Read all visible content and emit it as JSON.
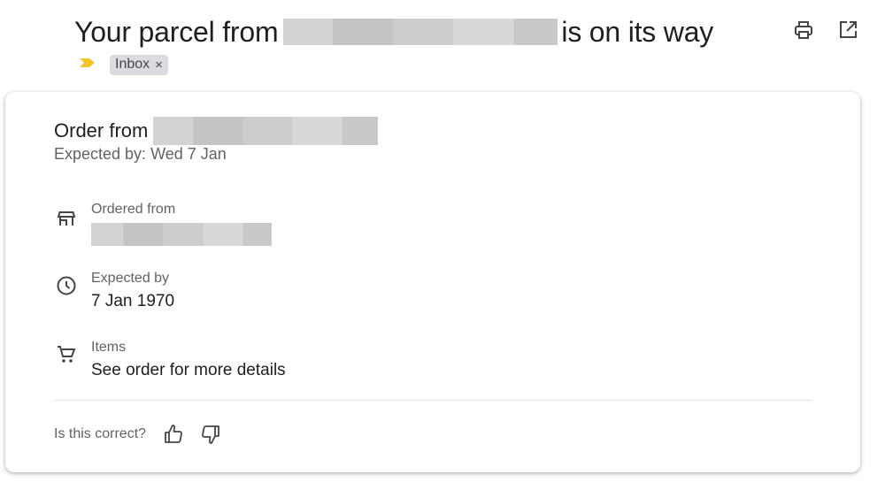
{
  "email": {
    "subject_prefix": "Your parcel from",
    "subject_suffix": "is on its way",
    "label_chip": "Inbox",
    "label_chip_remove": "×",
    "importance_color": "#f4c430"
  },
  "toolbar": {
    "print_icon": "print-icon",
    "open_new_window_icon": "open-in-new-icon"
  },
  "card": {
    "title_prefix": "Order from",
    "expected_line": "Expected by: Wed 7 Jan",
    "details": [
      {
        "icon": "store-icon",
        "label": "Ordered from",
        "value": ""
      },
      {
        "icon": "clock-icon",
        "label": "Expected by",
        "value": "7 Jan 1970"
      },
      {
        "icon": "cart-icon",
        "label": "Items",
        "value": "See order for more details"
      }
    ],
    "feedback_question": "Is this correct?",
    "feedback_icons": [
      "thumbs-up-icon",
      "thumbs-down-icon"
    ]
  }
}
